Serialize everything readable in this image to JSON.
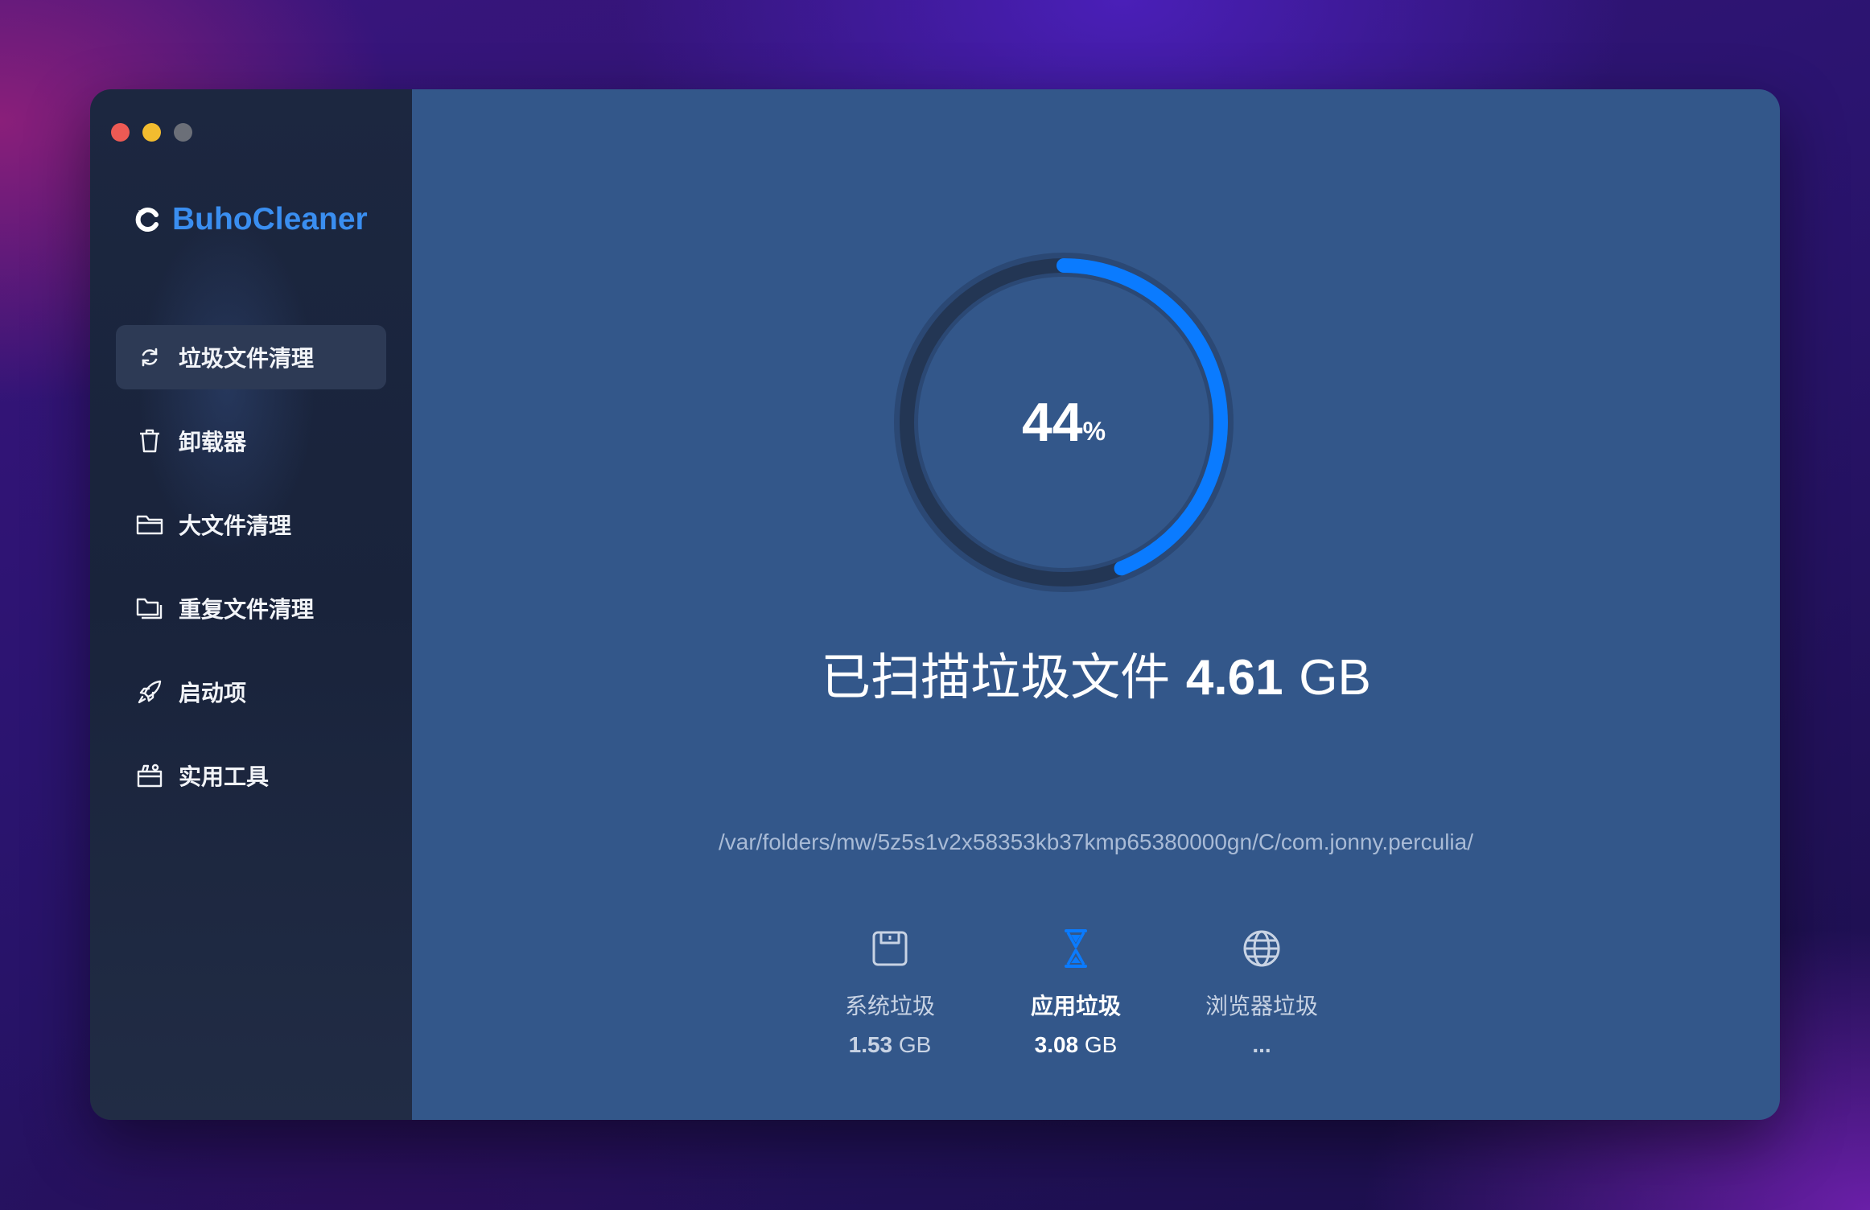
{
  "app": {
    "name": "BuhoCleaner"
  },
  "sidebar": {
    "items": [
      {
        "label": "垃圾文件清理",
        "icon": "refresh-icon",
        "active": true
      },
      {
        "label": "卸载器",
        "icon": "trash-icon",
        "active": false
      },
      {
        "label": "大文件清理",
        "icon": "folder-icon",
        "active": false
      },
      {
        "label": "重复文件清理",
        "icon": "duplicate-folder-icon",
        "active": false
      },
      {
        "label": "启动项",
        "icon": "rocket-icon",
        "active": false
      },
      {
        "label": "实用工具",
        "icon": "toolbox-icon",
        "active": false
      }
    ]
  },
  "scan": {
    "progress_number": "44",
    "progress_unit": "%",
    "progress_fraction": 0.44,
    "headline_prefix": "已扫描垃圾文件",
    "headline_amount": "4.61",
    "headline_unit": "GB",
    "current_path": "/var/folders/mw/5z5s1v2x58353kb37kmp65380000gn/C/com.jonny.perculia/"
  },
  "categories": [
    {
      "label": "系统垃圾",
      "value": "1.53",
      "unit": "GB",
      "icon": "disk-icon",
      "highlighted": false
    },
    {
      "label": "应用垃圾",
      "value": "3.08",
      "unit": "GB",
      "icon": "hourglass-icon",
      "highlighted": true
    },
    {
      "label": "浏览器垃圾",
      "value": "...",
      "unit": "",
      "icon": "globe-icon",
      "highlighted": false
    }
  ],
  "colors": {
    "accent": "#0a7bff",
    "brand": "#3a8ef0",
    "sidebar_bg": "#1c2740",
    "main_bg": "#33578a",
    "ring_track": "#233654"
  }
}
